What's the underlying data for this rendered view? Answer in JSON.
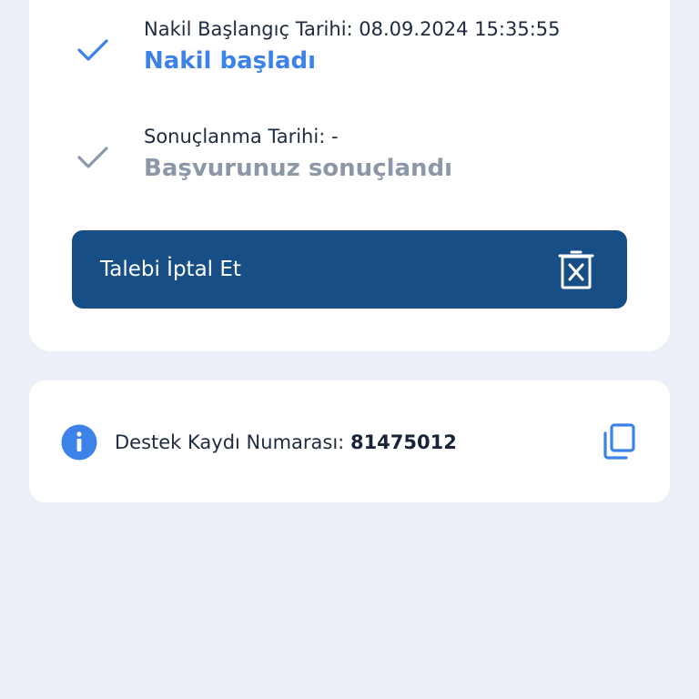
{
  "steps": [
    {
      "label": "Nakil Başlangıç Tarihi: 08.09.2024 15:35:55",
      "status": "Nakil başladı",
      "icon": "check-icon",
      "color": "#3d82e8"
    },
    {
      "label": "Sonuçlanma Tarihi: -",
      "status": "Başvurunuz sonuçlandı",
      "icon": "check-icon",
      "color": "#8c97a8"
    }
  ],
  "cancel_button": {
    "label": "Talebi İptal Et",
    "icon": "delete-icon",
    "color": "#174e85"
  },
  "support": {
    "label": "Destek Kaydı Numarası:",
    "number": "81475012",
    "info_icon": "info-icon",
    "copy_icon": "copy-icon"
  },
  "colors": {
    "background": "#ebeff7",
    "accent": "#3d82e8"
  }
}
